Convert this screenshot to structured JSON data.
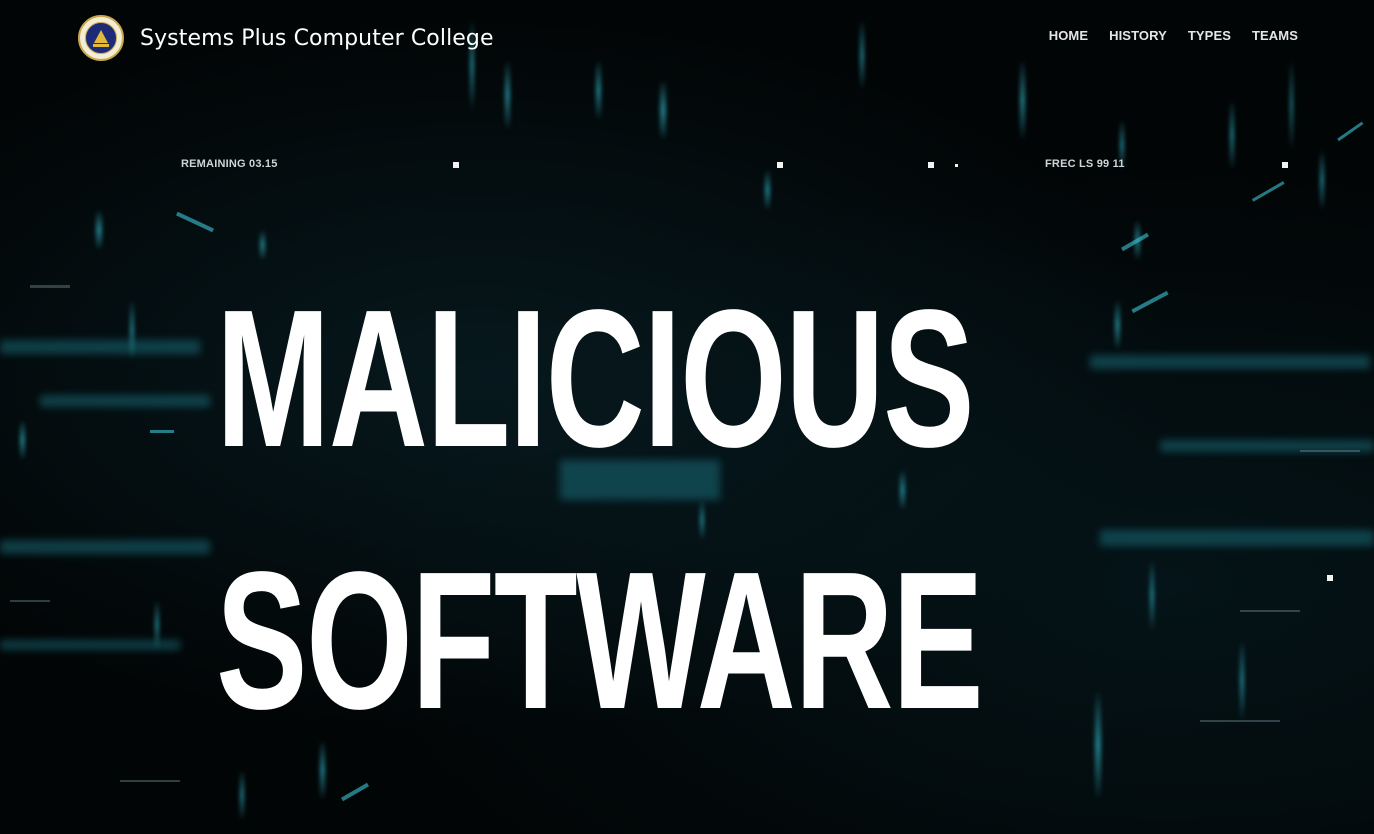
{
  "header": {
    "brand": "Systems Plus Computer College",
    "logo_icon": "college-seal-icon",
    "nav": [
      {
        "label": "HOME"
      },
      {
        "label": "HISTORY"
      },
      {
        "label": "TYPES"
      },
      {
        "label": "TEAMS"
      }
    ]
  },
  "hud": {
    "left_label": "REMAINING 03.15",
    "right_label": "FREC LS 99 11"
  },
  "hero": {
    "line1": "MALICIOUS",
    "line2": "SOFTWARE"
  },
  "colors": {
    "background": "#020506",
    "accent_teal": "#2fb4c6",
    "text": "#ffffff"
  }
}
